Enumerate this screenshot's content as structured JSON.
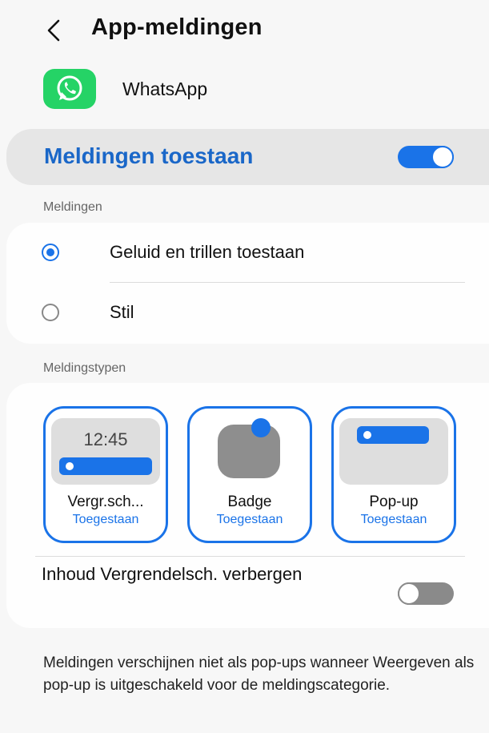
{
  "header": {
    "title": "App-meldingen"
  },
  "app": {
    "name": "WhatsApp"
  },
  "master": {
    "label": "Meldingen toestaan",
    "enabled": true
  },
  "meldingen": {
    "section_label": "Meldingen",
    "options": [
      {
        "label": "Geluid en trillen toestaan",
        "selected": true
      },
      {
        "label": "Stil",
        "selected": false
      }
    ]
  },
  "types": {
    "section_label": "Meldingstypen",
    "items": [
      {
        "name": "Vergr.sch...",
        "status": "Toegestaan",
        "clock": "12:45"
      },
      {
        "name": "Badge",
        "status": "Toegestaan"
      },
      {
        "name": "Pop-up",
        "status": "Toegestaan"
      }
    ],
    "lock_content": {
      "label": "Inhoud Vergrendelsch. verbergen",
      "enabled": false
    }
  },
  "footer": {
    "text": "Meldingen verschijnen niet als pop-ups wanneer Weergeven als pop-up is uitgeschakeld voor de meldingscategorie."
  },
  "colors": {
    "accent": "#1a73e8",
    "whatsapp": "#25d366"
  }
}
